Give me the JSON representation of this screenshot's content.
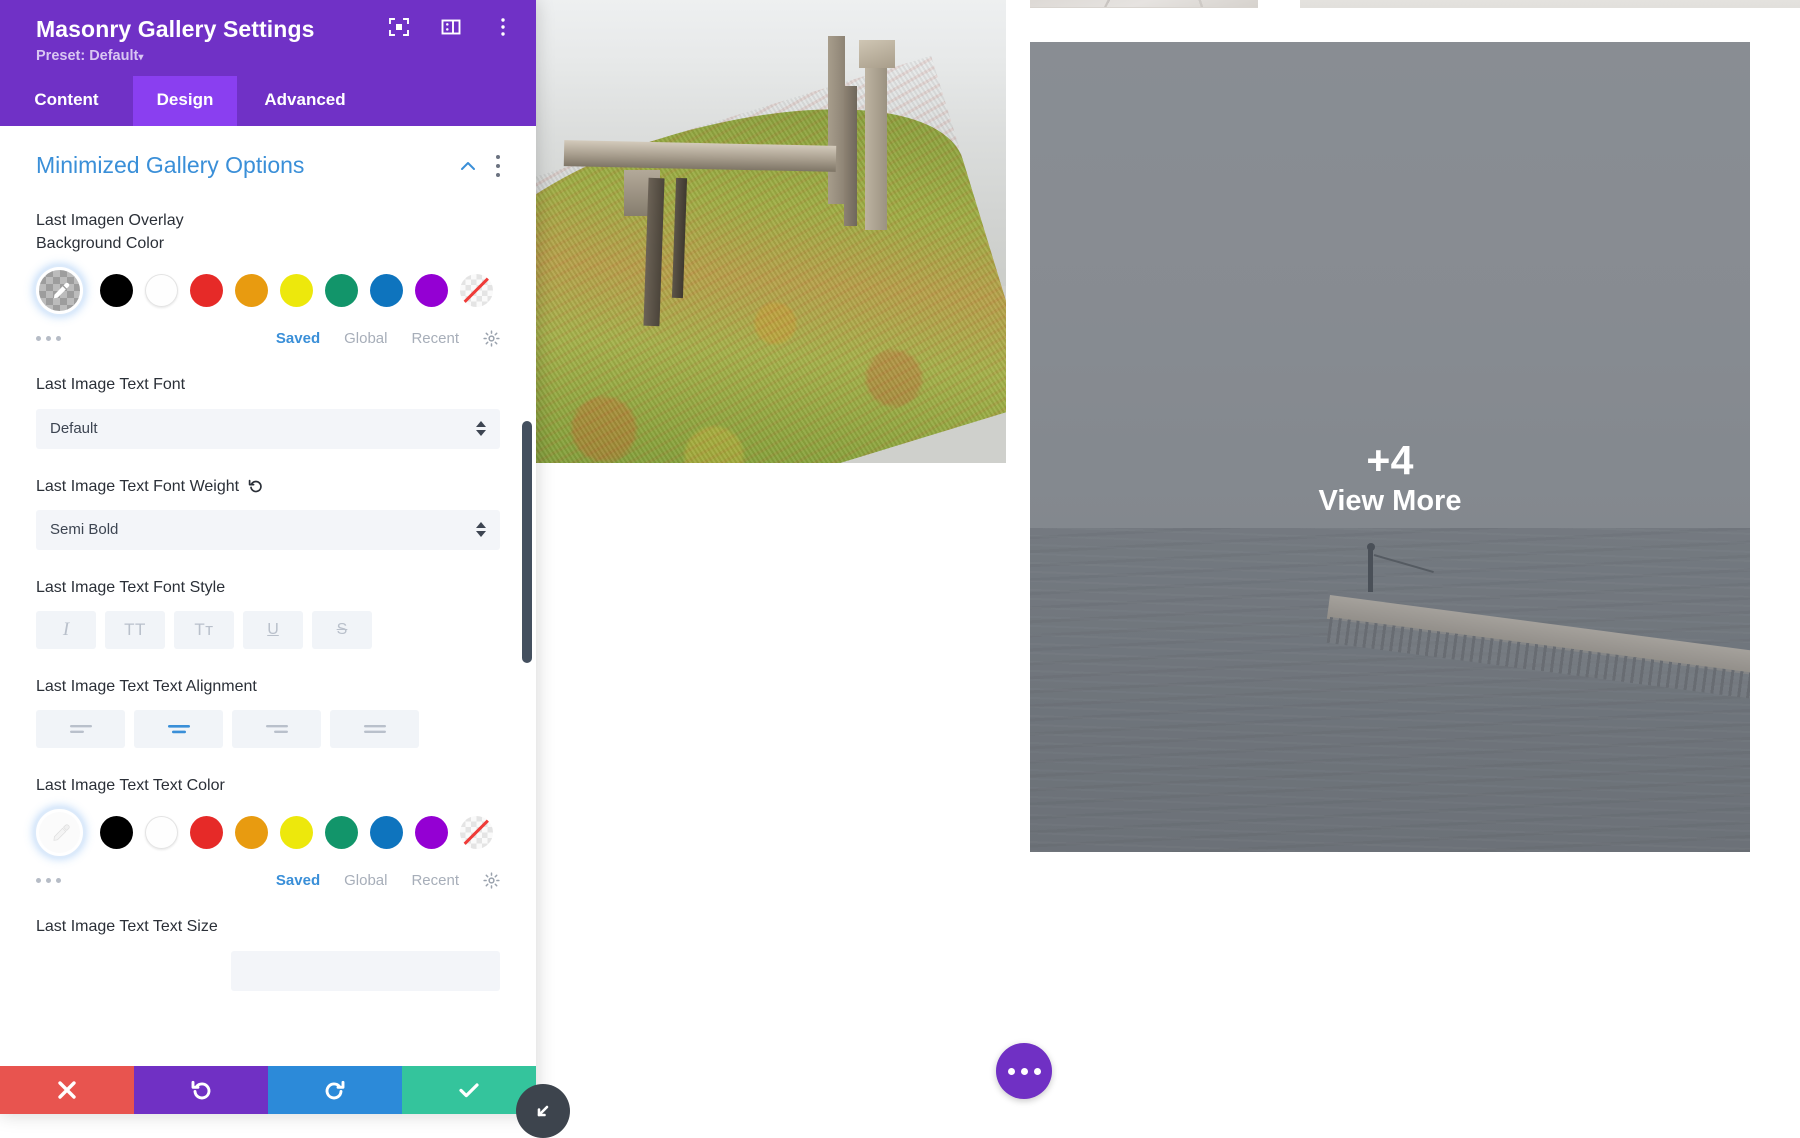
{
  "modal": {
    "title": "Masonry Gallery Settings",
    "preset_label": "Preset: Default",
    "preset_caret": "▾",
    "head_icons": [
      {
        "name": "focus-icon"
      },
      {
        "name": "layout-panel-icon"
      },
      {
        "name": "overflow-menu-icon"
      }
    ],
    "tabs": [
      {
        "label": "Content",
        "active": false
      },
      {
        "label": "Design",
        "active": true
      },
      {
        "label": "Advanced",
        "active": false
      }
    ],
    "section": {
      "title": "Minimized Gallery Options",
      "collapse_icon": "chevron-up-icon",
      "menu_icon": "kebab-menu-icon"
    },
    "fields": {
      "overlay_bg": {
        "label": "Last Imagen Overlay Background Color",
        "links": [
          "Saved",
          "Global",
          "Recent"
        ],
        "active_link": "Saved"
      },
      "text_font": {
        "label": "Last Image Text Font",
        "value": "Default"
      },
      "font_weight": {
        "label": "Last Image Text Font Weight",
        "value": "Semi Bold",
        "has_reset": true
      },
      "font_style": {
        "label": "Last Image Text Font Style",
        "buttons": [
          "I",
          "TT",
          "Tᴛ",
          "U",
          "S"
        ]
      },
      "text_align": {
        "label": "Last Image Text Text Alignment",
        "options": [
          "left",
          "center",
          "right",
          "justify"
        ],
        "active_index": 1
      },
      "text_color": {
        "label": "Last Image Text Text Color",
        "links": [
          "Saved",
          "Global",
          "Recent"
        ],
        "active_link": "Saved"
      },
      "text_size": {
        "label": "Last Image Text Text Size"
      }
    },
    "palette": [
      {
        "name": "black",
        "hex": "#000000"
      },
      {
        "name": "white",
        "hex": "#FFFFFF"
      },
      {
        "name": "red",
        "hex": "#E62A28"
      },
      {
        "name": "orange",
        "hex": "#E89B10"
      },
      {
        "name": "yellow",
        "hex": "#EDE80C"
      },
      {
        "name": "green",
        "hex": "#12956A"
      },
      {
        "name": "blue",
        "hex": "#0E74BE"
      },
      {
        "name": "purple",
        "hex": "#9400D3"
      },
      {
        "name": "none",
        "hex": "transparent"
      }
    ],
    "actions": [
      {
        "name": "cancel-button",
        "icon": "x-icon",
        "color": "#E8544F"
      },
      {
        "name": "undo-button",
        "icon": "undo-icon",
        "color": "#7030C4"
      },
      {
        "name": "redo-button",
        "icon": "redo-icon",
        "color": "#2C8AD9"
      },
      {
        "name": "save-button",
        "icon": "check-icon",
        "color": "#34C49C"
      }
    ]
  },
  "canvas": {
    "overlay": {
      "count": "+4",
      "label": "View More"
    },
    "fab": {
      "name": "page-settings-button"
    },
    "resize": {
      "name": "resize-handle"
    }
  },
  "colors": {
    "header_purple": "#7031C6",
    "tab_active_purple": "#8A3FF0",
    "accent_blue": "#3A8FD8",
    "overlay_gray": "#7D8288"
  }
}
